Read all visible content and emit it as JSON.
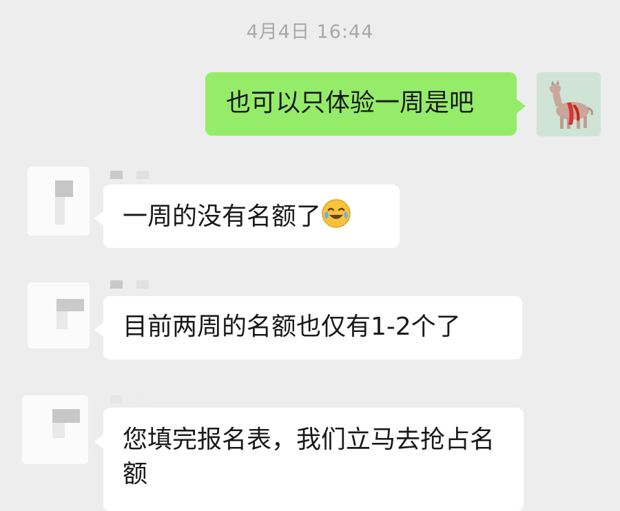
{
  "chat": {
    "timestamp": "4月4日 16:44",
    "messages": [
      {
        "sender": "self",
        "text": "也可以只体验一周是吧"
      },
      {
        "sender": "other",
        "text": "一周的没有名额了",
        "emoji": "crying-laughing-emoji"
      },
      {
        "sender": "other",
        "text": "目前两周的名额也仅有1-2个了"
      },
      {
        "sender": "other",
        "text": "您填完报名表，我们立马去抢占名额"
      }
    ]
  }
}
